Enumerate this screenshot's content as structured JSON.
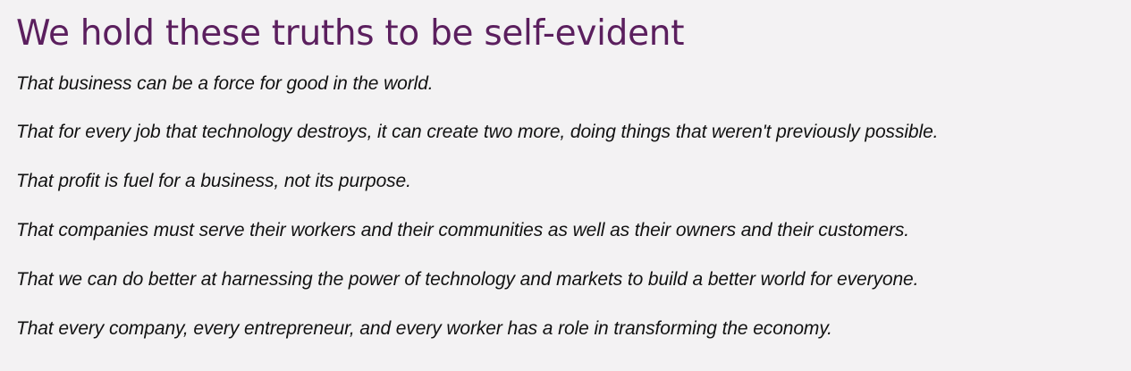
{
  "page": {
    "title": "We hold these truths to be self-evident",
    "truths": [
      "That business can be a force for good in the world.",
      "That for every job that technology destroys, it can create two more, doing things that weren't previously possible.",
      "That profit is fuel for a business, not its purpose.",
      "That companies must serve their workers and their communities as well as their owners and their customers.",
      "That we can do better at harnessing the power of technology and markets to build a better world for everyone.",
      "That every company, every entrepreneur, and every worker has a role in transforming the economy."
    ]
  },
  "colors": {
    "background": "#f3f2f3",
    "heading": "#5b1f5e",
    "body_text": "#111111"
  }
}
